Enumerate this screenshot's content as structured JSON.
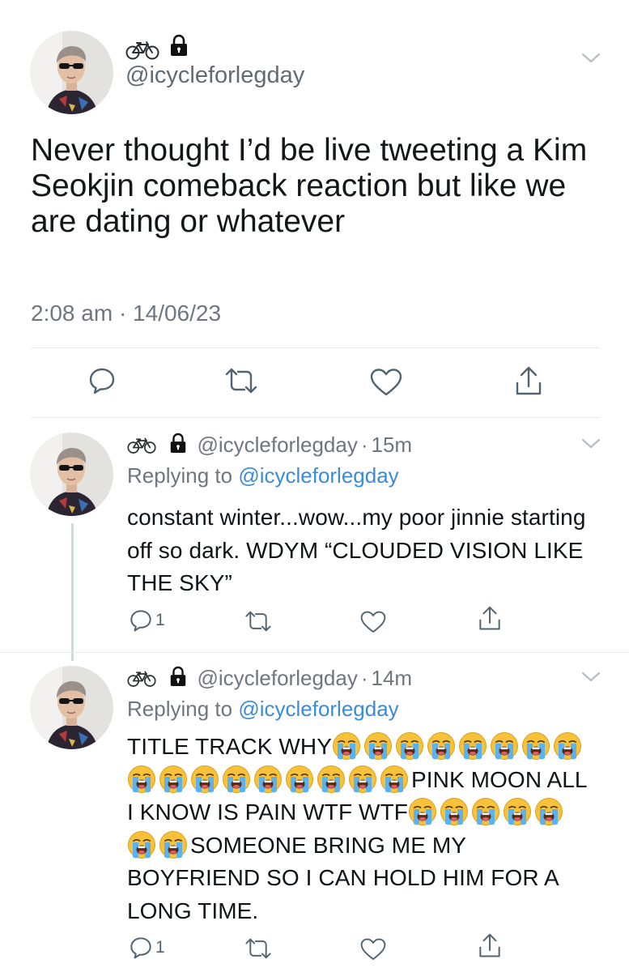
{
  "main_tweet": {
    "handle": "@icycleforlegday",
    "name_icons": [
      "bicycle-icon",
      "lock-icon"
    ],
    "text": "Never thought I’d be live tweeting a Kim Seokjin comeback reaction but like we are dating or whatever",
    "timestamp": "2:08 am · 14/06/23"
  },
  "replies": [
    {
      "handle": "@icycleforlegday",
      "separator": "·",
      "time": "15m",
      "replying_prefix": "Replying to ",
      "replying_to": "@icycleforlegday",
      "text": "constant winter...wow...my poor jinnie starting off so dark. WDYM “CLOUDED VISION LIKE THE SKY”",
      "reply_count": "1"
    },
    {
      "handle": "@icycleforlegday",
      "separator": "·",
      "time": "14m",
      "replying_prefix": "Replying to ",
      "replying_to": "@icycleforlegday",
      "text_parts": [
        "TITLE TRACK WHY",
        "PINK MOON ALL I KNOW IS PAIN WTF WTF",
        "SOMEONE BRING ME MY BOYFRIEND SO I CAN HOLD HIM FOR A LONG TIME."
      ],
      "emoji_groups": [
        17,
        7
      ],
      "emoji_name": "loudly-crying-face-emoji",
      "reply_count": "1"
    }
  ],
  "colors": {
    "text": "#0f1419",
    "muted": "#6e7781",
    "link": "#3b8bd8",
    "divider": "#e6e9ec",
    "thread_line": "#cfd9de"
  }
}
